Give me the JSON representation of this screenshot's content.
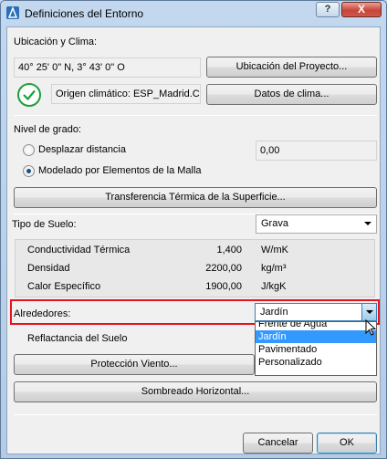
{
  "window": {
    "title": "Definiciones del Entorno",
    "help_label": "?",
    "close_label": "X"
  },
  "location": {
    "section_label": "Ubicación y Clima:",
    "coordinates": "40° 25' 0\" N, 3° 43' 0\" O",
    "project_location_button": "Ubicación del Proyecto...",
    "climate_origin": "Origen climático: ESP_Madrid.C",
    "climate_data_button": "Datos de clima..."
  },
  "grade": {
    "section_label": "Nivel de grado:",
    "options": [
      {
        "label": "Desplazar distancia",
        "selected": false
      },
      {
        "label": "Modelado por Elementos de la Malla",
        "selected": true
      }
    ],
    "offset_value": "0,00",
    "thermal_transfer_button": "Transferencia Térmica de la Superficie..."
  },
  "soil": {
    "label": "Tipo de Suelo:",
    "value": "Grava",
    "properties": [
      {
        "name": "Conductividad Térmica",
        "value": "1,400",
        "unit": "W/mK"
      },
      {
        "name": "Densidad",
        "value": "2200,00",
        "unit": "kg/m³"
      },
      {
        "name": "Calor Específico",
        "value": "1900,00",
        "unit": "J/kgK"
      }
    ]
  },
  "surroundings": {
    "label": "Alrededores:",
    "value": "Jardín",
    "options": [
      "Frente de Agua",
      "Jardín",
      "Pavimentado",
      "Personalizado"
    ],
    "selected_index": 1
  },
  "reflectance_label": "Reflactancia del Suelo",
  "wind_protection_button": "Protección Viento...",
  "horizontal_shading_button": "Sombreado Horizontal...",
  "footer": {
    "cancel_label": "Cancelar",
    "ok_label": "OK"
  },
  "colors": {
    "highlight": "#e4141e",
    "selection": "#3399ff",
    "check": "#1e9e3a"
  }
}
